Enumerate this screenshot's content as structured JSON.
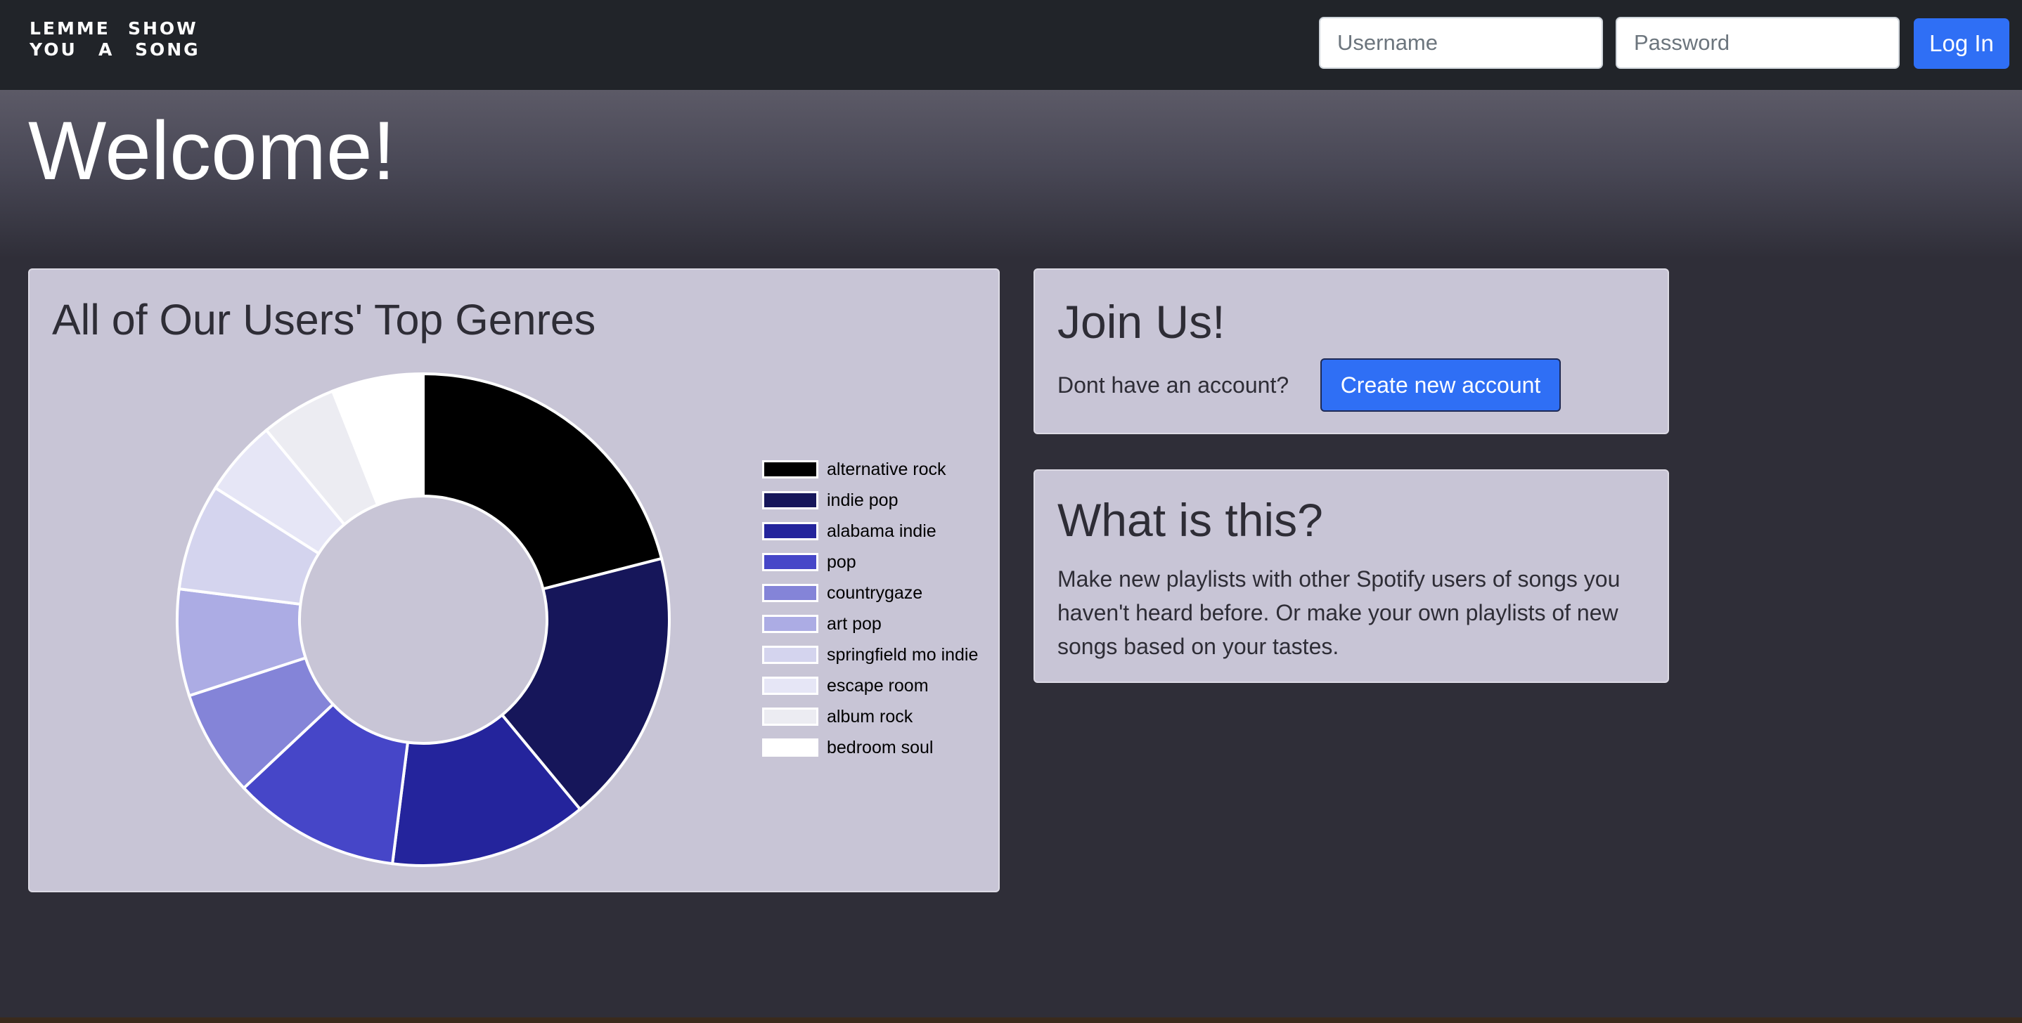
{
  "navbar": {
    "brand_words": [
      "LEMME",
      "SHOW",
      "YOU",
      "A",
      "SONG"
    ],
    "username_placeholder": "Username",
    "password_placeholder": "Password",
    "login_label": "Log In"
  },
  "hero": {
    "title": "Welcome!"
  },
  "genres_card": {
    "title": "All of Our Users' Top Genres"
  },
  "join_card": {
    "title": "Join Us!",
    "text": "Dont have an account?",
    "button_label": "Create new account"
  },
  "about_card": {
    "title": "What is this?",
    "text": "Make new playlists with other Spotify users of songs you haven't heard before. Or make your own playlists of new songs based on your tastes."
  },
  "colors": {
    "accent": "#2f6ff5",
    "navbar": "#212429",
    "background": "#2f2e38",
    "card": "#c8c5d6"
  },
  "chart_data": {
    "type": "pie",
    "title": "",
    "donut": true,
    "categories": [
      "alternative rock",
      "indie pop",
      "alabama indie",
      "pop",
      "countrygaze",
      "art pop",
      "springfield mo indie",
      "escape room",
      "album rock",
      "bedroom soul"
    ],
    "values": [
      21,
      18,
      13,
      11,
      7,
      7,
      7,
      5,
      5,
      6
    ],
    "colors": [
      "#000000",
      "#16165a",
      "#24249c",
      "#4646c8",
      "#8484d8",
      "#acacE4",
      "#d4d4ee",
      "#e6e6f6",
      "#ececf2",
      "#ffffff"
    ],
    "legend": "right"
  }
}
